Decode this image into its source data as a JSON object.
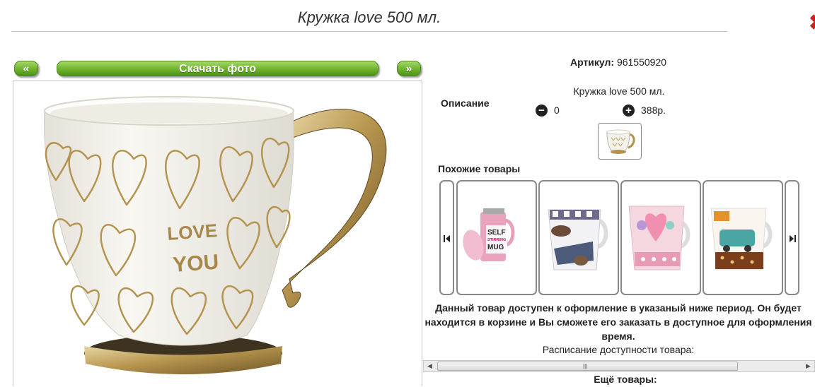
{
  "page": {
    "title": "Кружка love 500 мл.",
    "close_icon": "close-icon"
  },
  "photo_nav": {
    "prev_label": "«",
    "download_label": "Скачать фото",
    "next_label": "»"
  },
  "photo": {
    "mug_text_line1": "LOVE",
    "mug_text_line2": "YOU"
  },
  "product": {
    "article_label": "Артикул:",
    "article_value": "961550920",
    "description_label": "Описание",
    "name": "Кружка love 500 мл.",
    "quantity": "0",
    "price": "388р."
  },
  "similar": {
    "label": "Похожие товары",
    "items": [
      {
        "text_lines": [
          "SELF",
          "STIRRING",
          "MUG"
        ]
      },
      {
        "text_lines": []
      },
      {
        "text_lines": []
      },
      {
        "text_lines": []
      }
    ]
  },
  "availability": {
    "notice": "Данный товар доступен к оформление в указаный ниже период. Он будет находится в корзине и Вы сможете его заказать в доступное для оформления время.",
    "schedule_label": "Расписание доступности товара:"
  },
  "more": {
    "label": "Ещё товары:"
  },
  "colors": {
    "accent_green": "#6fb22c",
    "close_red": "#d31f1f",
    "gold": "#b89a55"
  }
}
